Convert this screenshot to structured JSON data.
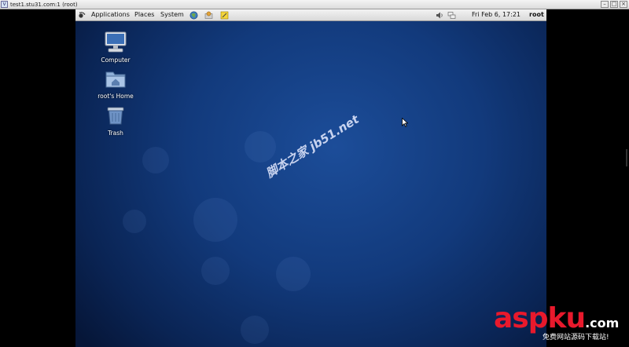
{
  "window": {
    "title": "test1.stu31.com:1 (root)",
    "icon_glyph": "V",
    "controls": [
      "–",
      "□",
      "×"
    ]
  },
  "panel": {
    "menus": [
      "Applications",
      "Places",
      "System"
    ],
    "launcher_icons": [
      "web-browser-icon",
      "email-client-icon",
      "notes-editor-icon"
    ],
    "tray_icons": [
      "volume-icon",
      "network-icon"
    ],
    "clock": "Fri Feb  6, 17:21",
    "user": "root"
  },
  "desktop": {
    "icons": [
      {
        "name": "computer-icon",
        "label": "Computer"
      },
      {
        "name": "home-folder-icon",
        "label": "root's Home"
      },
      {
        "name": "trash-icon",
        "label": "Trash"
      }
    ],
    "watermark": "脚本之家 jb51.net"
  },
  "logo": {
    "main_red": "asp",
    "main_white": "ku",
    "suffix": ".com",
    "tagline": "免费网站源码下载站!"
  },
  "colors": {
    "desktop_center": "#1c4d99",
    "desktop_edge": "#061638",
    "logo_red": "#e8192c",
    "panel_bg": "#e6e6e6"
  }
}
